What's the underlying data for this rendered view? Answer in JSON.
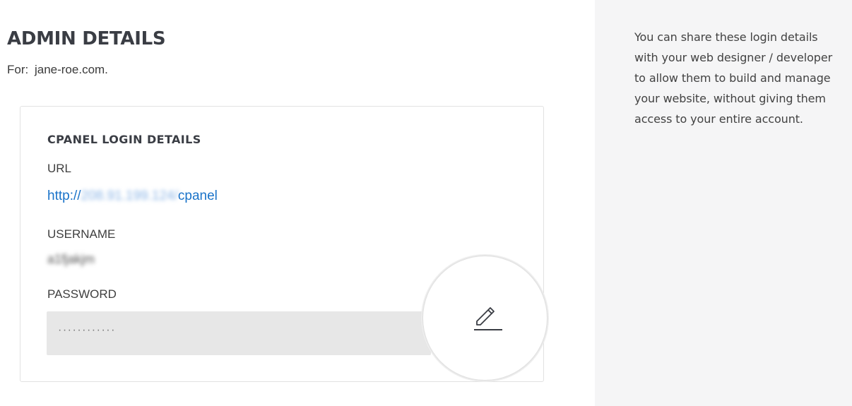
{
  "header": {
    "title": "ADMIN DETAILS",
    "for_label": "For:",
    "domain": "jane-roe.com."
  },
  "card": {
    "title": "CPANEL LOGIN DETAILS",
    "url_label": "URL",
    "url_prefix": "http://",
    "url_blurred": "208.91.199.124/",
    "url_suffix": "cpanel",
    "username_label": "USERNAME",
    "username_value": "a1fjakjm",
    "password_label": "PASSWORD",
    "password_value": "············",
    "edit_icon": "pencil-icon"
  },
  "aside": {
    "text": "You can share these login details with your web designer / developer to allow them to build and manage your website, without giving them access to your entire account."
  },
  "colors": {
    "link": "#1a73c9",
    "aside_bg": "#f5f5f6",
    "password_bg": "#e7e7e7",
    "title": "#3a3d44"
  }
}
